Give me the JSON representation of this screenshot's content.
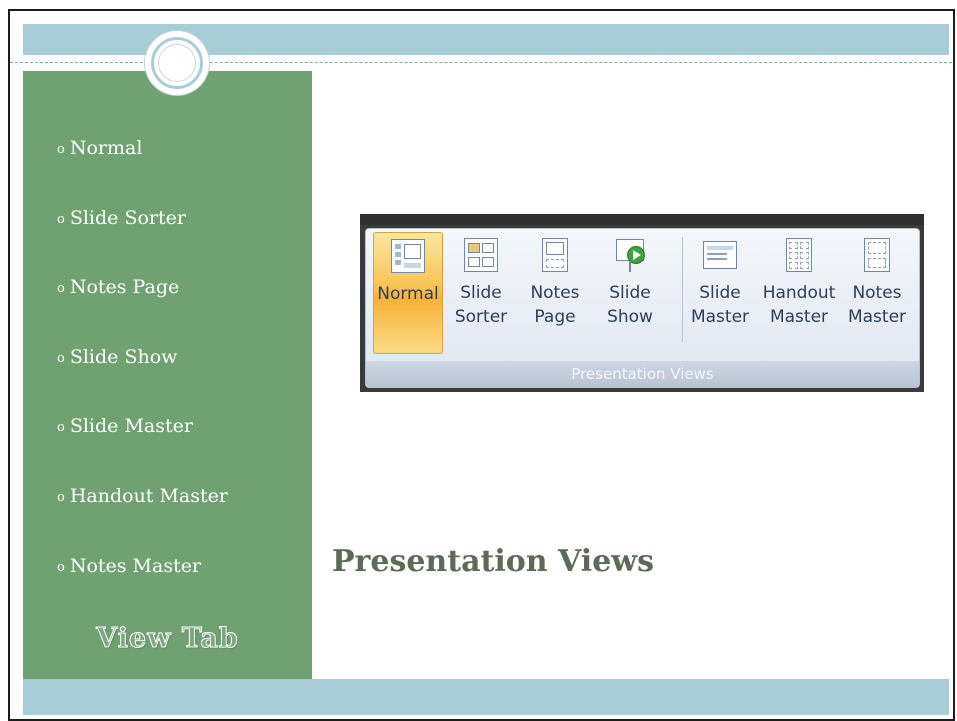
{
  "sidebar": {
    "items": [
      {
        "label": "Normal"
      },
      {
        "label": "Slide Sorter"
      },
      {
        "label": "Notes Page"
      },
      {
        "label": "Slide Show"
      },
      {
        "label": "Slide Master"
      },
      {
        "label": "Handout Master"
      },
      {
        "label": "Notes Master"
      }
    ],
    "bullet": "o",
    "footer_label": "View Tab"
  },
  "main": {
    "title": "Presentation Views"
  },
  "ribbon": {
    "group_label": "Presentation Views",
    "active_button": "Normal",
    "buttons": [
      {
        "line1": "Normal",
        "line2": "",
        "icon": "normal-view-icon"
      },
      {
        "line1": "Slide",
        "line2": "Sorter",
        "icon": "slide-sorter-icon"
      },
      {
        "line1": "Notes",
        "line2": "Page",
        "icon": "notes-page-icon"
      },
      {
        "line1": "Slide",
        "line2": "Show",
        "icon": "slide-show-icon"
      },
      {
        "line1": "Slide",
        "line2": "Master",
        "icon": "slide-master-icon"
      },
      {
        "line1": "Handout",
        "line2": "Master",
        "icon": "handout-master-icon"
      },
      {
        "line1": "Notes",
        "line2": "Master",
        "icon": "notes-master-icon"
      }
    ]
  },
  "colors": {
    "sidebar_green": "#6fa171",
    "band_blue": "#a9cdd6",
    "title_color": "#5c6a56",
    "active_orange": "#f9c352"
  }
}
